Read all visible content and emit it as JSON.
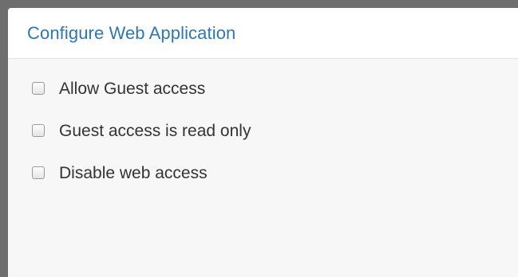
{
  "dialog": {
    "title": "Configure Web Application"
  },
  "options": [
    {
      "label": "Allow Guest access",
      "checked": false
    },
    {
      "label": "Guest access is read only",
      "checked": false
    },
    {
      "label": "Disable web access",
      "checked": false
    }
  ],
  "colors": {
    "title": "#2f77b3",
    "text": "#333333",
    "panel_background": "#f7f7f7",
    "frame": "#6e6e6e"
  }
}
